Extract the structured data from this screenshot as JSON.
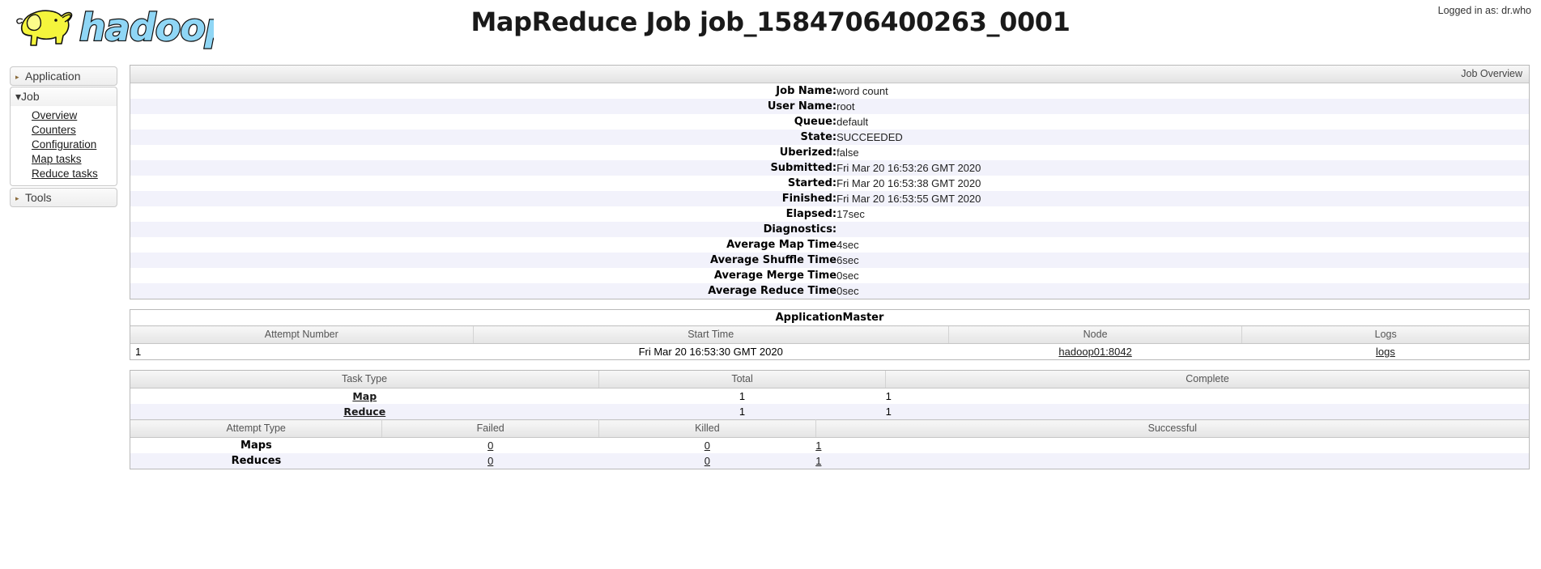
{
  "header": {
    "logged_in_text": "Logged in as: dr.who",
    "logo_text": "hadoop",
    "title": "MapReduce Job job_1584706400263_0001"
  },
  "nav": {
    "application": {
      "label": "Application",
      "arrow": "▸"
    },
    "job": {
      "label": "Job",
      "arrow": "▾"
    },
    "job_links": [
      {
        "label": "Overview"
      },
      {
        "label": "Counters"
      },
      {
        "label": "Configuration"
      },
      {
        "label": "Map tasks"
      },
      {
        "label": "Reduce tasks"
      }
    ],
    "tools": {
      "label": "Tools",
      "arrow": "▸"
    }
  },
  "overview": {
    "caption": "Job Overview",
    "rows": [
      {
        "key": "Job Name:",
        "value": "word count"
      },
      {
        "key": "User Name:",
        "value": "root"
      },
      {
        "key": "Queue:",
        "value": "default"
      },
      {
        "key": "State:",
        "value": "SUCCEEDED"
      },
      {
        "key": "Uberized:",
        "value": "false"
      },
      {
        "key": "Submitted:",
        "value": "Fri Mar 20 16:53:26 GMT 2020"
      },
      {
        "key": "Started:",
        "value": "Fri Mar 20 16:53:38 GMT 2020"
      },
      {
        "key": "Finished:",
        "value": "Fri Mar 20 16:53:55 GMT 2020"
      },
      {
        "key": "Elapsed:",
        "value": "17sec"
      },
      {
        "key": "Diagnostics:",
        "value": ""
      },
      {
        "key": "Average Map Time",
        "value": "4sec"
      },
      {
        "key": "Average Shuffle Time",
        "value": "6sec"
      },
      {
        "key": "Average Merge Time",
        "value": "0sec"
      },
      {
        "key": "Average Reduce Time",
        "value": "0sec"
      }
    ]
  },
  "appmaster": {
    "caption": "ApplicationMaster",
    "columns": [
      "Attempt Number",
      "Start Time",
      "Node",
      "Logs"
    ],
    "rows": [
      {
        "attempt": "1",
        "start_time": "Fri Mar 20 16:53:30 GMT 2020",
        "node": "hadoop01:8042",
        "logs": "logs"
      }
    ]
  },
  "tasks": {
    "columns": [
      "Task Type",
      "Total",
      "Complete"
    ],
    "rows": [
      {
        "type": "Map",
        "total": "1",
        "complete": "1"
      },
      {
        "type": "Reduce",
        "total": "1",
        "complete": "1"
      }
    ]
  },
  "attempts": {
    "columns": [
      "Attempt Type",
      "Failed",
      "Killed",
      "Successful"
    ],
    "rows": [
      {
        "type": "Maps",
        "failed": "0",
        "killed": "0",
        "successful": "1"
      },
      {
        "type": "Reduces",
        "failed": "0",
        "killed": "0",
        "successful": "1"
      }
    ]
  },
  "colors": {
    "row_alt": "#f2f2fb",
    "logo_text": "#8fd6f5",
    "logo_elephant": "#f5f53c"
  }
}
